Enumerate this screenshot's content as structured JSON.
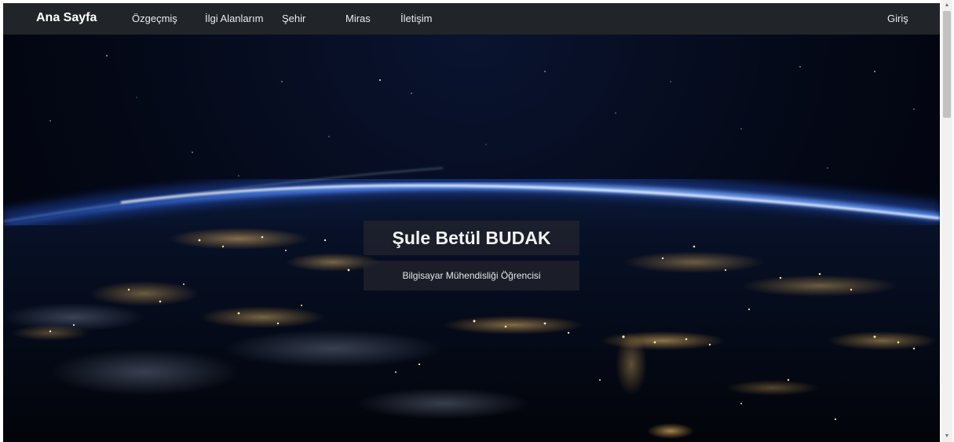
{
  "navbar": {
    "brand": "Ana Sayfa",
    "items": [
      {
        "label": "Özgeçmiş"
      },
      {
        "label": "İlgi Alanlarım"
      },
      {
        "label": "Şehir"
      },
      {
        "label": "Miras"
      },
      {
        "label": "İletişim"
      }
    ],
    "login": "Giriş"
  },
  "hero": {
    "title": "Şule Betül BUDAK",
    "subtitle": "Bilgisayar Mühendisliği Öğrencisi",
    "image": "earth-from-space-at-night"
  },
  "colors": {
    "navbar_bg": "#212529",
    "atmosphere": "#3b7dff"
  }
}
